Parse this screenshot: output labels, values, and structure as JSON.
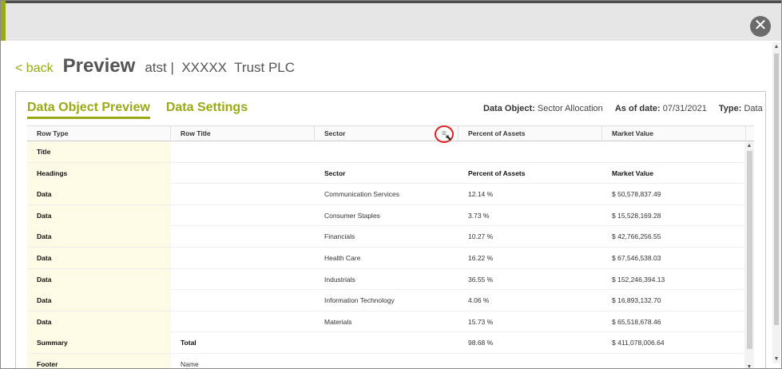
{
  "dialog": {
    "close_icon": "close-icon",
    "close_glyph": "✕"
  },
  "header": {
    "back_label": "< back",
    "title": "Preview",
    "subtitle": "atst |  XXXXX  Trust PLC"
  },
  "tabs": [
    {
      "label": "Data Object Preview",
      "active": true
    },
    {
      "label": "Data Settings",
      "active": false
    }
  ],
  "meta": {
    "data_object_label": "Data Object:",
    "data_object_value": "Sector Allocation",
    "as_of_label": "As of date:",
    "as_of_value": "07/31/2021",
    "type_label": "Type:",
    "type_value": "Data"
  },
  "grid": {
    "columns": [
      "Row Type",
      "Row Title",
      "Sector",
      "Percent of Assets",
      "Market Value"
    ],
    "column_menu_icon": "column-menu-icon",
    "rows": [
      {
        "type": "Title",
        "title": "",
        "sector": "",
        "percent": "",
        "value": "",
        "bold": false
      },
      {
        "type": "Headings",
        "title": "",
        "sector": "Sector",
        "percent": "Percent of Assets",
        "value": "Market Value",
        "bold": true
      },
      {
        "type": "Data",
        "title": "",
        "sector": "Communication Services",
        "percent": "12.14 %",
        "value": "$ 50,578,837.49",
        "bold": false
      },
      {
        "type": "Data",
        "title": "",
        "sector": "Consumer Staples",
        "percent": "3.73 %",
        "value": "$ 15,528,169.28",
        "bold": false
      },
      {
        "type": "Data",
        "title": "",
        "sector": "Financials",
        "percent": "10.27 %",
        "value": "$ 42,766,256.55",
        "bold": false
      },
      {
        "type": "Data",
        "title": "",
        "sector": "Health Care",
        "percent": "16.22 %",
        "value": "$ 67,546,538.03",
        "bold": false
      },
      {
        "type": "Data",
        "title": "",
        "sector": "Industrials",
        "percent": "36.55 %",
        "value": "$ 152,246,394.13",
        "bold": false
      },
      {
        "type": "Data",
        "title": "",
        "sector": "Information Technology",
        "percent": "4.06 %",
        "value": "$ 16,893,132.70",
        "bold": false
      },
      {
        "type": "Data",
        "title": "",
        "sector": "Materials",
        "percent": "15.73 %",
        "value": "$ 65,518,678.46",
        "bold": false
      },
      {
        "type": "Summary",
        "title": "Total",
        "sector": "",
        "percent": "98.68 %",
        "value": "$ 411,078,006.64",
        "bold": false
      },
      {
        "type": "Footer",
        "title": "Name",
        "sector": "",
        "percent": "",
        "value": "",
        "bold": false
      }
    ]
  },
  "colors": {
    "accent": "#9aa915",
    "highlight_circle": "#e02020"
  }
}
